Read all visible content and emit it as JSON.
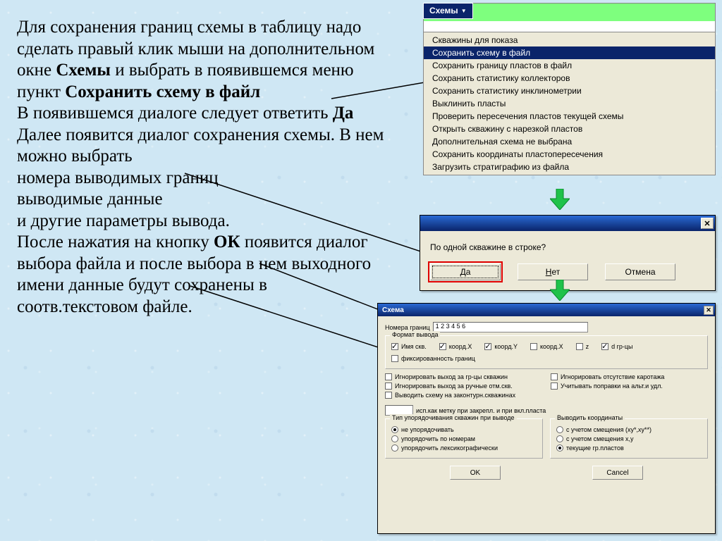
{
  "instructions": {
    "p1a": "Для сохранения границ схемы в таблицу надо сделать правый клик мыши на дополнительном окне ",
    "p1b_bold": "Схемы",
    "p1c": " и выбрать в появившемся меню пункт ",
    "p1d_bold": "Сохранить схему в файл",
    "p2a": "В появившемся диалоге следует ответить ",
    "p2b_bold": "Да",
    "p3": "Далее появится диалог сохранения схемы. В нем можно выбрать",
    "p4": "номера выводимых границ",
    "p5": "выводимые данные",
    "p6": "и другие параметры вывода.",
    "p7a": "После нажатия на кнопку ",
    "p7b_bold": "ОК",
    "p7c": " появится диалог выбора файла и после выбора в нем выходного имени данные будут сохранены в соотв.текстовом файле."
  },
  "panel1": {
    "button": "Схемы",
    "menu": [
      "Скважины для показа",
      "Сохранить схему в файл",
      "Сохранить границу пластов в файл",
      "Сохранить статистику коллекторов",
      "Сохранить статистику инклинометрии",
      "Выклинить пласты",
      "Проверить пересечения пластов текущей схемы",
      "Открыть скважину с нарезкой пластов",
      "Дополнительная схема не выбрана",
      "Сохранить координаты пластопересечения",
      "Загрузить стратиграфию из файла"
    ],
    "selected_index": 1
  },
  "panel2": {
    "question": "По одной скважине в строке?",
    "yes": "Да",
    "no": "Нет",
    "cancel": "Отмена"
  },
  "panel3": {
    "title": "Схема",
    "row_num_label": "Номера границ",
    "row_num_value": "1 2 3 4 5 6",
    "format_group": "Формат вывода",
    "chk_name_skv": "Имя скв.",
    "chk_coord_x1": "коорд.X",
    "chk_coord_y1": "коорд.Y",
    "chk_coord_x2": "коорд.X",
    "chk_z": "z",
    "chk_grcy": "d гр-цы",
    "chk_fix": "фиксированность границ",
    "ign1": "Игнорировать выход за гр-цы скважин",
    "ign2": "Игнорировать выход за ручные отм.скв.",
    "ign3": "Выводить схему на законтурн.скважинах",
    "ign_r1": "Игнорировать отсутствие каротажа",
    "ign_r2": "Учитывать поправки на альт.и удл.",
    "input_note": "исп.как метку при закрепл. и при вкл.пласта",
    "sort_group": "Тип упорядочивания скважин при выводе",
    "sort1": "не упорядочивать",
    "sort2": "упорядочить по номерам",
    "sort3": "упорядочить лексикографически",
    "coord_group": "Выводить координаты",
    "coord1": "с учетом смещения (xy*,xy**)",
    "coord2": "с учетом смещения x,y",
    "coord3": "текущие гр.пластов",
    "ok": "OK",
    "cancel": "Cancel"
  }
}
